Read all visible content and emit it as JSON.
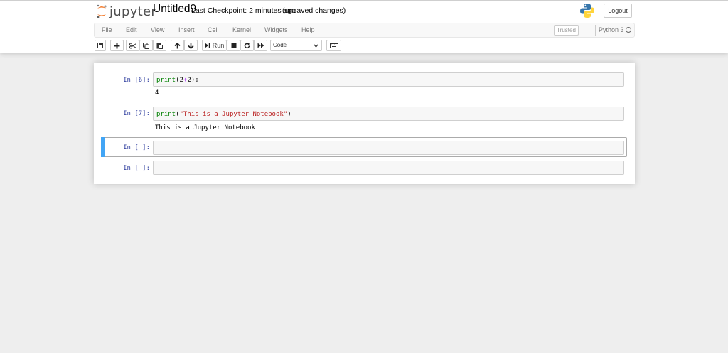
{
  "header": {
    "logo_text": "jupyter",
    "notebook_name": "Untitled9",
    "checkpoint": "Last Checkpoint: 2 minutes ago",
    "autosave_status": "(unsaved changes)",
    "logout_label": "Logout"
  },
  "menubar": {
    "items": [
      "File",
      "Edit",
      "View",
      "Insert",
      "Cell",
      "Kernel",
      "Widgets",
      "Help"
    ],
    "trusted_label": "Trusted",
    "kernel_name": "Python 3"
  },
  "toolbar": {
    "run_label": "Run",
    "cell_type": "Code",
    "buttons": [
      "save-icon",
      "plus-icon",
      "cut-icon",
      "copy-icon",
      "paste-icon",
      "arrow-up-icon",
      "arrow-down-icon",
      "run-icon",
      "stop-icon",
      "restart-icon",
      "fast-forward-icon",
      "keyboard-icon"
    ]
  },
  "cells": [
    {
      "prompt": "In [6]:",
      "code_fn": "print",
      "code_open": "(",
      "code_arg1": "2",
      "code_op": "+",
      "code_arg2": "2",
      "code_close": ");",
      "output": "4"
    },
    {
      "prompt": "In [7]:",
      "code_fn": "print",
      "code_open": "(",
      "code_str": "\"This is a Jupyter Notebook\"",
      "code_close": ")",
      "output": "This is a Jupyter Notebook"
    },
    {
      "prompt": "In [ ]:"
    },
    {
      "prompt": "In [ ]:"
    }
  ],
  "colors": {
    "accent_selected": "#42a5f5",
    "prompt": "#303f9f",
    "logo_orange": "#f37726"
  }
}
